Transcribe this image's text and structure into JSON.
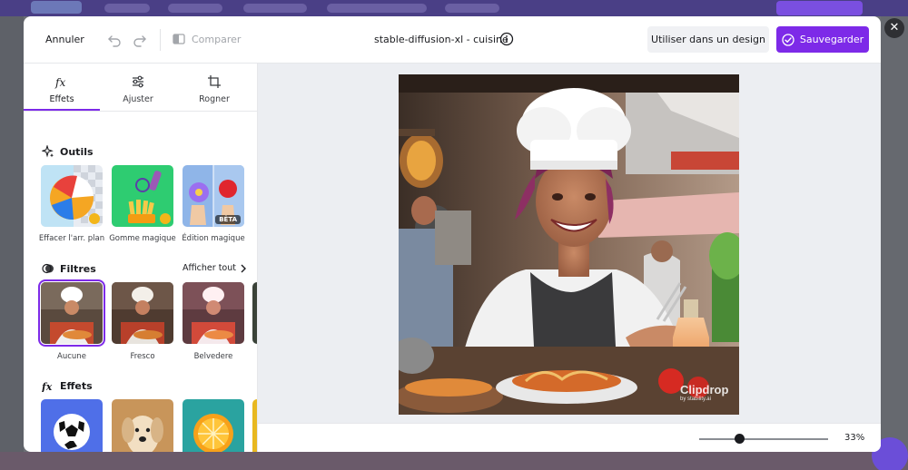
{
  "modal": {
    "cancel_label": "Annuler",
    "compare_label": "Comparer",
    "doc_title": "stable-diffusion-xl - cuisine",
    "use_label": "Utiliser dans un design",
    "save_label": "Sauvegarder"
  },
  "tabs": [
    {
      "label": "Effets",
      "icon": "fx-icon",
      "active": true
    },
    {
      "label": "Ajuster",
      "icon": "sliders-icon",
      "active": false
    },
    {
      "label": "Rogner",
      "icon": "crop-icon",
      "active": false
    }
  ],
  "tools": {
    "heading": "Outils",
    "items": [
      {
        "label": "Effacer l'arr. plan",
        "premium": true
      },
      {
        "label": "Gomme magique",
        "premium": true
      },
      {
        "label": "Édition magique",
        "badge": "BÊTA"
      }
    ]
  },
  "filters": {
    "heading": "Filtres",
    "see_all": "Afficher tout",
    "items": [
      {
        "label": "Aucune",
        "selected": true
      },
      {
        "label": "Fresco",
        "selected": false
      },
      {
        "label": "Belvedere",
        "selected": false
      }
    ]
  },
  "effects": {
    "heading": "Effets"
  },
  "canvas": {
    "watermark": "Clipdrop",
    "watermark_sub": "by stability.ai"
  },
  "zoom": {
    "value_label": "33%",
    "level": 0.33
  },
  "colors": {
    "accent": "#7d2ae8",
    "premium_crown": "#f3b619"
  }
}
